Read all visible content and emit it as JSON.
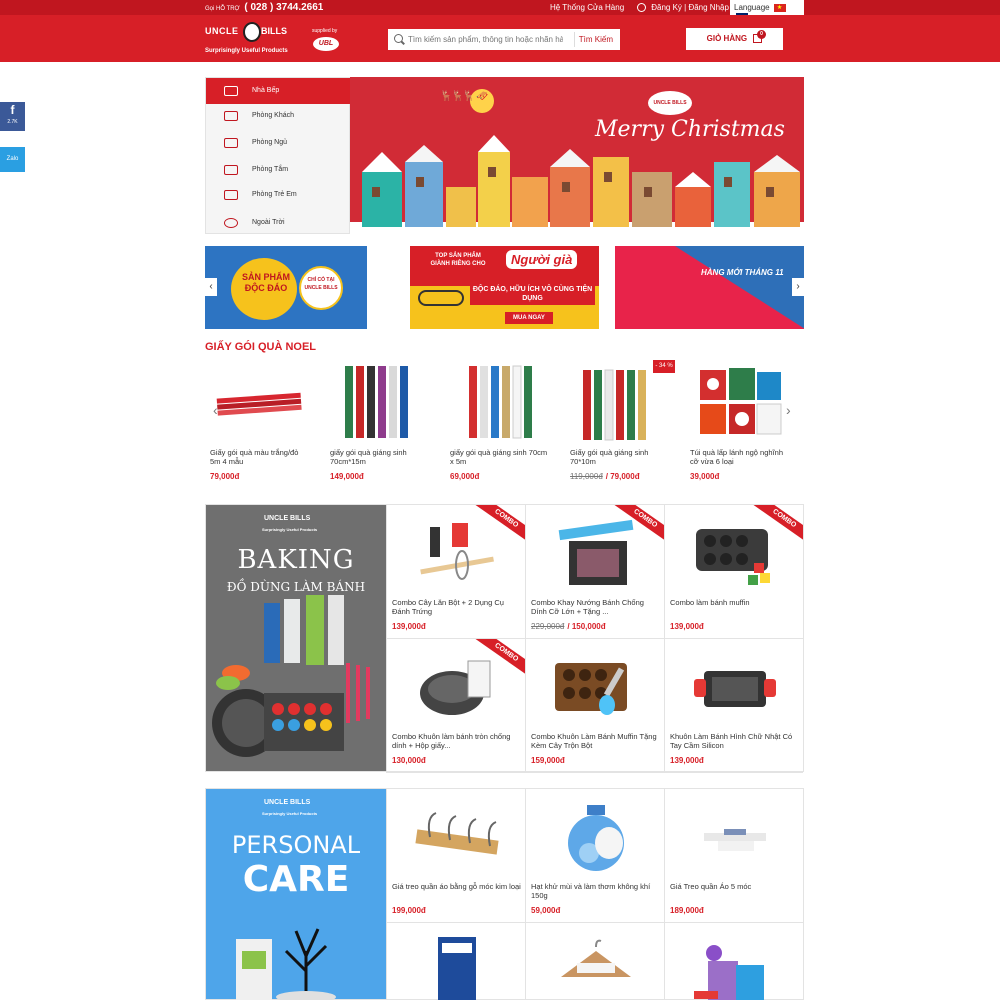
{
  "topbar": {
    "hotline_label": "Gọi HỖ TRỢ",
    "hotline_number": "( 028 ) 3744.2661",
    "stores": "Hệ Thống Cửa Hàng",
    "account": "Đăng Ký | Đăng Nhập",
    "language": "Language"
  },
  "header": {
    "logo_left": "UNCLE",
    "logo_right": "BILLS",
    "logo_tagline": "Surprisingly Useful Products",
    "supplied_by": "supplied by",
    "ubl": "UBL",
    "search_placeholder": "Tìm kiếm sản phẩm, thông tin hoặc nhãn hàng mong muốn",
    "search_button": "Tìm Kiếm",
    "cart_label": "GIỎ HÀNG",
    "cart_count": "0"
  },
  "social": {
    "facebook_count": "2.7K",
    "zalo": "Zalo"
  },
  "categories": [
    {
      "label": "Nhà Bếp",
      "active": true
    },
    {
      "label": "Phòng Khách"
    },
    {
      "label": "Phòng Ngủ"
    },
    {
      "label": "Phòng Tắm"
    },
    {
      "label": "Phòng Trẻ Em"
    },
    {
      "label": "Ngoài Trời"
    }
  ],
  "hero": {
    "title": "Merry Christmas",
    "logo": "UNCLE BILLS"
  },
  "promos": {
    "p1_title": "SẢN PHẨM ĐỘC ĐÁO",
    "p1_badge": "CHỈ CÓ TẠI UNCLE BILLS",
    "p2_top": "TOP SẢN PHẨM GIÀNH RIÊNG CHO",
    "p2_highlight": "Người già",
    "p2_sub": "ĐỘC ĐÁO, HỮU ÍCH VÔ CÙNG TIỆN DỤNG",
    "p2_button": "MUA NGAY",
    "p3_title": "HÀNG MỚI THÁNG 11"
  },
  "noel_section": {
    "title": "GIẤY GÓI QUÀ NOEL",
    "products": [
      {
        "name": "Giấy gói quà màu trắng/đỏ 5m 4 mẫu",
        "price": "79,000đ"
      },
      {
        "name": "giấy gói quà giáng sinh 70cm*15m",
        "price": "149,000đ"
      },
      {
        "name": "giấy gói quà giáng sinh 70cm x 5m",
        "price": "69,000đ"
      },
      {
        "name": "Giấy gói quà giáng sinh 70*10m",
        "old_price": "119,000đ",
        "price": "79,000đ",
        "discount": "- 34 %"
      },
      {
        "name": "Túi quà lấp lánh ngộ nghĩnh cỡ vừa 6 loại",
        "price": "39,000đ"
      }
    ]
  },
  "baking": {
    "brand": "UNCLE BILLS",
    "tagline": "Surprisingly Useful Products",
    "title": "BAKING",
    "subtitle": "ĐỒ DÙNG LÀM BÁNH",
    "combo_label": "COMBO",
    "products": [
      {
        "name": "Combo Cây Lăn Bột + 2 Dụng Cụ Đánh Trứng",
        "price": "139,000đ"
      },
      {
        "name": "Combo Khay Nướng Bánh Chống Dính Cỡ Lớn + Tặng ...",
        "old_price": "229,000đ",
        "price": "150,000đ"
      },
      {
        "name": "Combo làm bánh muffin",
        "price": "139,000đ"
      },
      {
        "name": "Combo Khuôn làm bánh tròn chống dính + Hộp giấy...",
        "price": "130,000đ"
      },
      {
        "name": "Combo Khuôn Làm Bánh Muffin Tặng Kèm Cây Trộn Bột",
        "price": "159,000đ"
      },
      {
        "name": "Khuôn Làm Bánh Hình Chữ Nhật Có Tay Cầm Silicon",
        "price": "139,000đ"
      }
    ]
  },
  "personal": {
    "brand": "UNCLE BILLS",
    "tagline": "Surprisingly Useful Products",
    "title1": "PERSONAL",
    "title2": "CARE",
    "products": [
      {
        "name": "Giá treo quần áo bằng gỗ móc kim loại",
        "price": "199,000đ"
      },
      {
        "name": "Hạt khử mùi và làm thơm không khí 150g",
        "price": "59,000đ"
      },
      {
        "name": "Giá Treo quần Áo 5 móc",
        "price": "189,000đ"
      }
    ]
  }
}
